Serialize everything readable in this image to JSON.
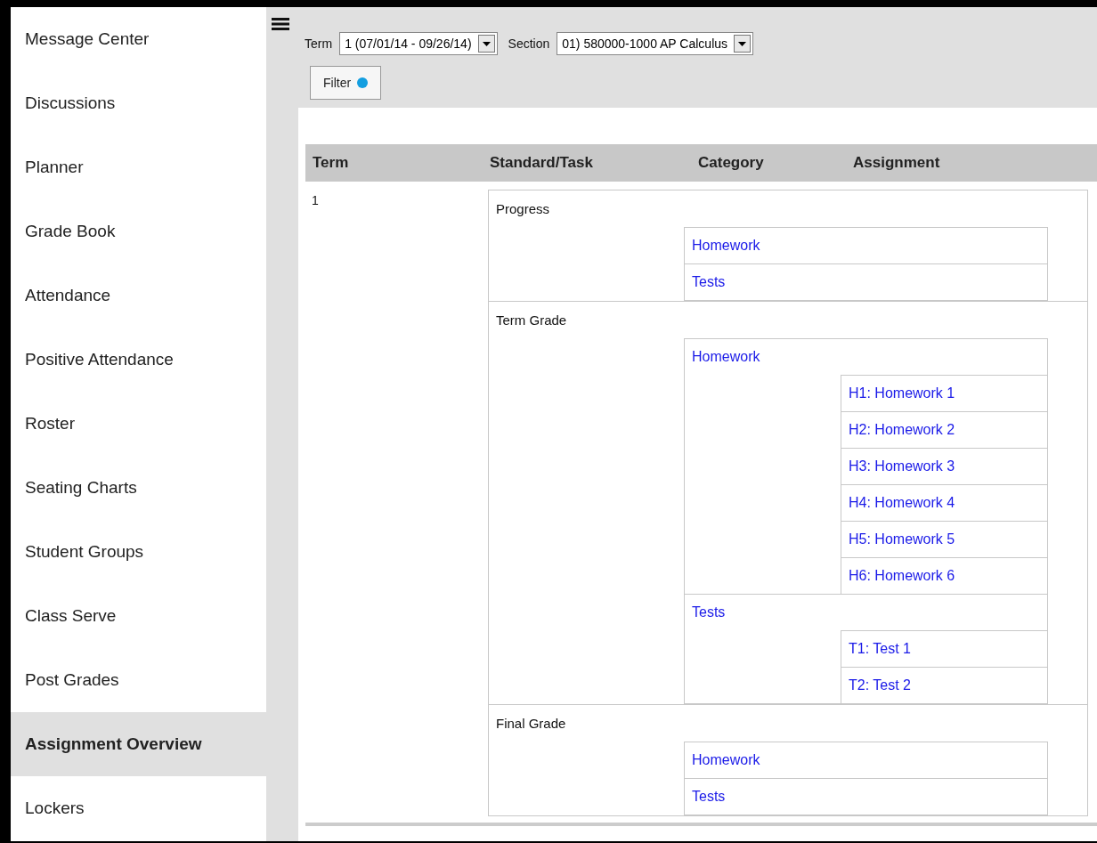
{
  "sidebar": {
    "items": [
      {
        "label": "Message Center",
        "selected": false
      },
      {
        "label": "Discussions",
        "selected": false
      },
      {
        "label": "Planner",
        "selected": false
      },
      {
        "label": "Grade Book",
        "selected": false
      },
      {
        "label": "Attendance",
        "selected": false
      },
      {
        "label": "Positive Attendance",
        "selected": false
      },
      {
        "label": "Roster",
        "selected": false
      },
      {
        "label": "Seating Charts",
        "selected": false
      },
      {
        "label": "Student Groups",
        "selected": false
      },
      {
        "label": "Class Serve",
        "selected": false
      },
      {
        "label": "Post Grades",
        "selected": false
      },
      {
        "label": "Assignment Overview",
        "selected": true
      },
      {
        "label": "Lockers",
        "selected": false
      }
    ]
  },
  "toolbar": {
    "term_label": "Term",
    "term_value": "1 (07/01/14 - 09/26/14)",
    "section_label": "Section",
    "section_value": "01) 580000-1000 AP Calculus",
    "filter": {
      "label": "Filter",
      "active": true
    }
  },
  "table": {
    "columns": [
      "Term",
      "Standard/Task",
      "Category",
      "Assignment"
    ],
    "rows": [
      {
        "term": "1",
        "standards": [
          {
            "name": "Progress",
            "categories": [
              {
                "name": "Homework"
              },
              {
                "name": "Tests"
              }
            ]
          },
          {
            "name": "Term Grade",
            "categories": [
              {
                "name": "Homework",
                "assignments": [
                  "H1: Homework 1",
                  "H2: Homework 2",
                  "H3: Homework 3",
                  "H4: Homework 4",
                  "H5: Homework 5",
                  "H6: Homework 6"
                ]
              },
              {
                "name": "Tests",
                "assignments": [
                  "T1: Test 1",
                  "T2: Test 2"
                ]
              }
            ]
          },
          {
            "name": "Final Grade",
            "categories": [
              {
                "name": "Homework"
              },
              {
                "name": "Tests"
              }
            ]
          }
        ]
      }
    ]
  }
}
